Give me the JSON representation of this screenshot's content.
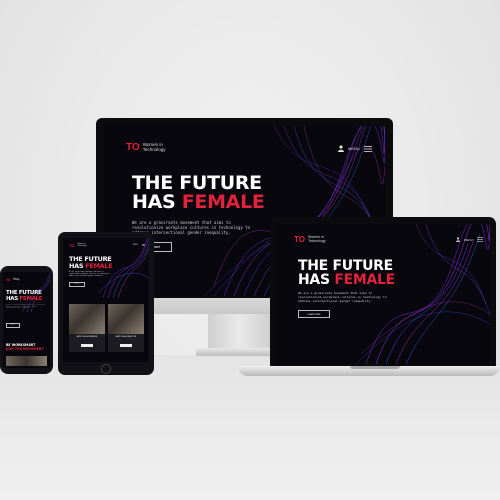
{
  "site": {
    "logo_mark": "TO",
    "logo_line1": "Women in",
    "logo_line2": "Technology",
    "menu_label": "MENU",
    "hero_line1": "THE FUTURE",
    "hero_line2_plain": "HAS ",
    "hero_line2_accent": "FEMALE",
    "description": "We are a grassroots movement that aims to revolutionize workplace cultures in technology to address intersectional gender inequality.",
    "cta_label": "Learn more"
  },
  "tablet": {
    "card1_title": "APPLY AS A MEMBER",
    "card2_title": "APPLY AS A MENTOR"
  },
  "phone": {
    "cta_line1": "BE WORKSMART",
    "cta_line2": "JOIN THE MOVEMENT"
  },
  "colors": {
    "accent": "#e0223a",
    "background": "#07070d",
    "wave_purple": "#8a2be2",
    "wave_blue": "#3a55ff"
  }
}
